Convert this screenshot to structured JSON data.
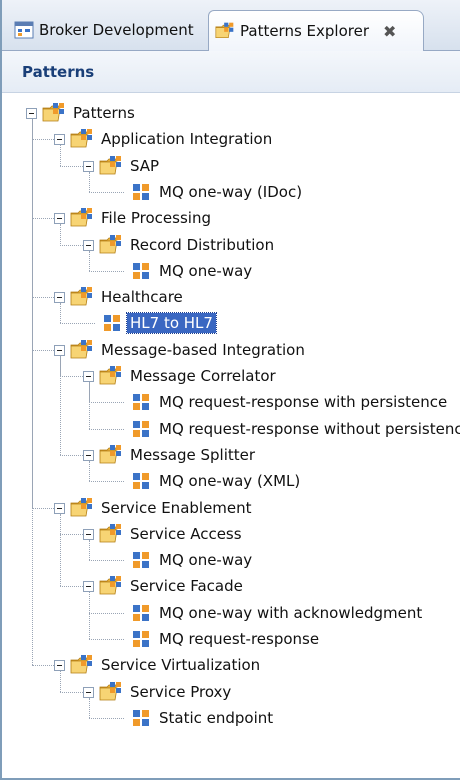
{
  "tabs": [
    {
      "label": "Broker Development",
      "active": false
    },
    {
      "label": "Patterns Explorer",
      "active": true,
      "close_glyph": "✖"
    }
  ],
  "view_title": "Patterns",
  "tree": {
    "root": "Patterns",
    "nodes": [
      {
        "label": "Application Integration",
        "type": "folder"
      },
      {
        "label": "SAP",
        "type": "folder"
      },
      {
        "label": "MQ one-way (IDoc)",
        "type": "pattern"
      },
      {
        "label": "File Processing",
        "type": "folder"
      },
      {
        "label": "Record Distribution",
        "type": "folder"
      },
      {
        "label": "MQ one-way",
        "type": "pattern"
      },
      {
        "label": "Healthcare",
        "type": "folder"
      },
      {
        "label": "HL7 to HL7",
        "type": "pattern",
        "selected": true
      },
      {
        "label": "Message-based Integration",
        "type": "folder"
      },
      {
        "label": "Message Correlator",
        "type": "folder"
      },
      {
        "label": "MQ request-response with persistence",
        "type": "pattern"
      },
      {
        "label": "MQ request-response without persistence",
        "type": "pattern"
      },
      {
        "label": "Message Splitter",
        "type": "folder"
      },
      {
        "label": "MQ one-way (XML)",
        "type": "pattern"
      },
      {
        "label": "Service Enablement",
        "type": "folder"
      },
      {
        "label": "Service Access",
        "type": "folder"
      },
      {
        "label": "MQ one-way",
        "type": "pattern"
      },
      {
        "label": "Service Facade",
        "type": "folder"
      },
      {
        "label": "MQ one-way with acknowledgment",
        "type": "pattern"
      },
      {
        "label": "MQ request-response",
        "type": "pattern"
      },
      {
        "label": "Service Virtualization",
        "type": "folder"
      },
      {
        "label": "Service Proxy",
        "type": "folder"
      },
      {
        "label": "Static endpoint",
        "type": "pattern"
      }
    ]
  },
  "colors": {
    "selection": "#3a67c2",
    "folder": "#f2c14e",
    "pattern_blue": "#3b73c7",
    "pattern_orange": "#f09a2a"
  }
}
